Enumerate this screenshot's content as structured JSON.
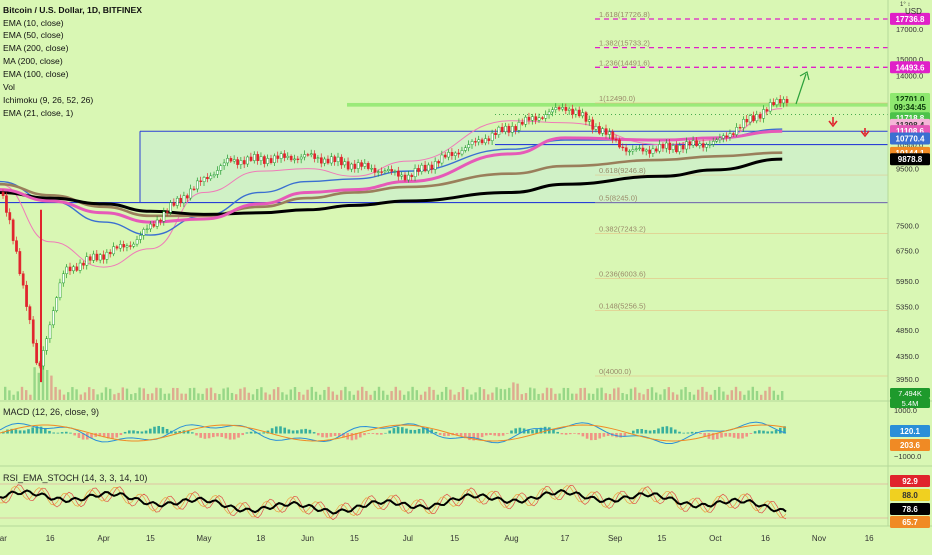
{
  "colors": {
    "background": "#d9f7b4",
    "bull": "#1e9a2c",
    "bear": "#e0242d",
    "ema10": "#f07ab8",
    "ema50": "#3a6fd1",
    "ema100": "#9a7f5b",
    "ema200": "#000000",
    "ma200": "#e659b8",
    "magenta_dash": "#e020c8",
    "blue_line": "#2a3fd6",
    "macd_line": "#2a8fd8",
    "signal_line": "#f08a24"
  },
  "legend": {
    "symbol": "Bitcoin / U.S. Dollar, 1D, BITFINEX",
    "indicators": [
      "EMA (10, close)",
      "EMA (50, close)",
      "EMA (200, close)",
      "MA (200, close)",
      "EMA (100, close)",
      "Vol",
      "Ichimoku (9, 26, 52, 26)",
      "EMA (21, close, 1)"
    ]
  },
  "top_right": {
    "currency": "USD",
    "marks": "1° ↕"
  },
  "fib_labels": [
    {
      "text": "1.618(17726.8)",
      "value": 17726.8
    },
    {
      "text": "1.382(15733.2)",
      "value": 15733.2
    },
    {
      "text": "1.236(14491.6)",
      "value": 14491.6
    },
    {
      "text": "1(12490.0)",
      "value": 12490.0
    },
    {
      "text": "0.618(9246.8)",
      "value": 9246.8
    },
    {
      "text": "0.5(8245.0)",
      "value": 8245.0
    },
    {
      "text": "0.382(7243.2)",
      "value": 7243.2
    },
    {
      "text": "0.236(6003.6)",
      "value": 6003.6
    },
    {
      "text": "0.148(5256.5)",
      "value": 5256.5
    },
    {
      "text": "0(4000.0)",
      "value": 4000.0
    }
  ],
  "price_axis": {
    "ticks": [
      "17000.0",
      "15000.0",
      "14000.0",
      "12500.0",
      "11500.0",
      "10500.0",
      "9500.0",
      "7500.0",
      "6750.0",
      "5950.0",
      "5350.0",
      "4850.0",
      "4350.0",
      "3950.0"
    ],
    "badges": [
      {
        "text": "17736.8",
        "value": 17736.8,
        "bg": "#e020c8",
        "fg": "#ffffff"
      },
      {
        "text": "14493.6",
        "value": 14493.6,
        "bg": "#e020c8",
        "fg": "#ffffff"
      },
      {
        "text": "12701.0",
        "value": 12701.0,
        "bg": "#8ee86f",
        "fg": "#0a3a0a"
      },
      {
        "text": "09:34:45",
        "value": 12280,
        "bg": "#8ee86f",
        "fg": "#0a3a0a"
      },
      {
        "text": "11718.8",
        "value": 11718.8,
        "bg": "#4cc24a",
        "fg": "#ffffff"
      },
      {
        "text": "11398.4",
        "value": 11398.4,
        "bg": "#f5b5d8",
        "fg": "#333333"
      },
      {
        "text": "11108.6",
        "value": 11108.6,
        "bg": "#e659b8",
        "fg": "#ffffff"
      },
      {
        "text": "10770.4",
        "value": 10770.4,
        "bg": "#3a6fd1",
        "fg": "#ffffff"
      },
      {
        "text": "10144.1",
        "value": 10144.1,
        "bg": "#f08a24",
        "fg": "#ffffff"
      },
      {
        "text": "9878.8",
        "value": 9878.8,
        "bg": "#000000",
        "fg": "#ffffff"
      }
    ]
  },
  "vol_badges": [
    "7.494K",
    "5.4M"
  ],
  "macd": {
    "title": "MACD (12, 26, close, 9)",
    "ticks": [
      "1000.0",
      "−1000.0"
    ],
    "badges": [
      {
        "text": "203.6",
        "bg": "#f08a24",
        "fg": "#ffffff"
      },
      {
        "text": "120.1",
        "bg": "#2a8fd8",
        "fg": "#ffffff"
      }
    ]
  },
  "rsi": {
    "title": "RSI_EMA_STOCH (14, 3, 3, 14, 10)",
    "badges": [
      {
        "text": "92.9",
        "bg": "#e0242d",
        "fg": "#ffffff"
      },
      {
        "text": "88.0",
        "bg": "#f0d020",
        "fg": "#333333"
      },
      {
        "text": "78.6",
        "bg": "#000000",
        "fg": "#ffffff"
      },
      {
        "text": "65.7",
        "bg": "#f08a24",
        "fg": "#ffffff"
      }
    ]
  },
  "time_axis": [
    "Mar",
    "16",
    "Apr",
    "15",
    "May",
    "18",
    "Jun",
    "15",
    "Jul",
    "15",
    "Aug",
    "17",
    "Sep",
    "15",
    "Oct",
    "16",
    "Nov",
    "16"
  ],
  "chart_data": {
    "type": "candlestick",
    "title": "Bitcoin / U.S. Dollar, 1D, BITFINEX",
    "y_scale": "log",
    "ylim": [
      3900,
      18200
    ],
    "key_points": [
      {
        "date": "Mar 1",
        "price": 8600
      },
      {
        "date": "Mar 12",
        "price": 4000
      },
      {
        "date": "Mar 20",
        "price": 6200
      },
      {
        "date": "Apr 10",
        "price": 7000
      },
      {
        "date": "May 8",
        "price": 9800
      },
      {
        "date": "Jun 1",
        "price": 10000
      },
      {
        "date": "Jul 1",
        "price": 9200
      },
      {
        "date": "Jul 27",
        "price": 11000
      },
      {
        "date": "Aug 17",
        "price": 12300
      },
      {
        "date": "Sep 5",
        "price": 10200
      },
      {
        "date": "Oct 1",
        "price": 10600
      },
      {
        "date": "Oct 21",
        "price": 12701
      }
    ],
    "series": [
      {
        "name": "EMA (10, close)",
        "values": [
          8900,
          7000,
          6300,
          6800,
          8600,
          9400,
          9500,
          9200,
          9800,
          11600,
          11500,
          10500,
          10700,
          12200
        ]
      },
      {
        "name": "EMA (50, close)",
        "values": [
          9000,
          8300,
          7600,
          7200,
          7800,
          8600,
          9000,
          9100,
          9400,
          10300,
          10700,
          10700,
          10800,
          11200
        ]
      },
      {
        "name": "EMA (100, close)",
        "values": [
          8900,
          8500,
          8100,
          7800,
          7800,
          8100,
          8400,
          8600,
          8800,
          9300,
          9600,
          9850,
          10000,
          10150
        ]
      },
      {
        "name": "EMA (200, close)",
        "values": [
          8600,
          8400,
          8200,
          7950,
          7850,
          7900,
          8000,
          8150,
          8300,
          8600,
          8900,
          9200,
          9450,
          9880
        ]
      },
      {
        "name": "MA (200, close)",
        "values": [
          8700,
          8300,
          7900,
          7600,
          7700,
          8200,
          8600,
          8700,
          9000,
          10100,
          10800,
          10700,
          10800,
          11100
        ]
      }
    ],
    "series_dates": [
      "Mar 1",
      "Mar 16",
      "Apr 1",
      "Apr 15",
      "May 1",
      "May 18",
      "Jun 1",
      "Jun 15",
      "Jul 1",
      "Aug 1",
      "Aug 17",
      "Sep 15",
      "Oct 1",
      "Oct 21"
    ],
    "horizontal_levels": [
      12490,
      12300,
      11900,
      11100,
      10500,
      9246.8,
      8245
    ]
  }
}
